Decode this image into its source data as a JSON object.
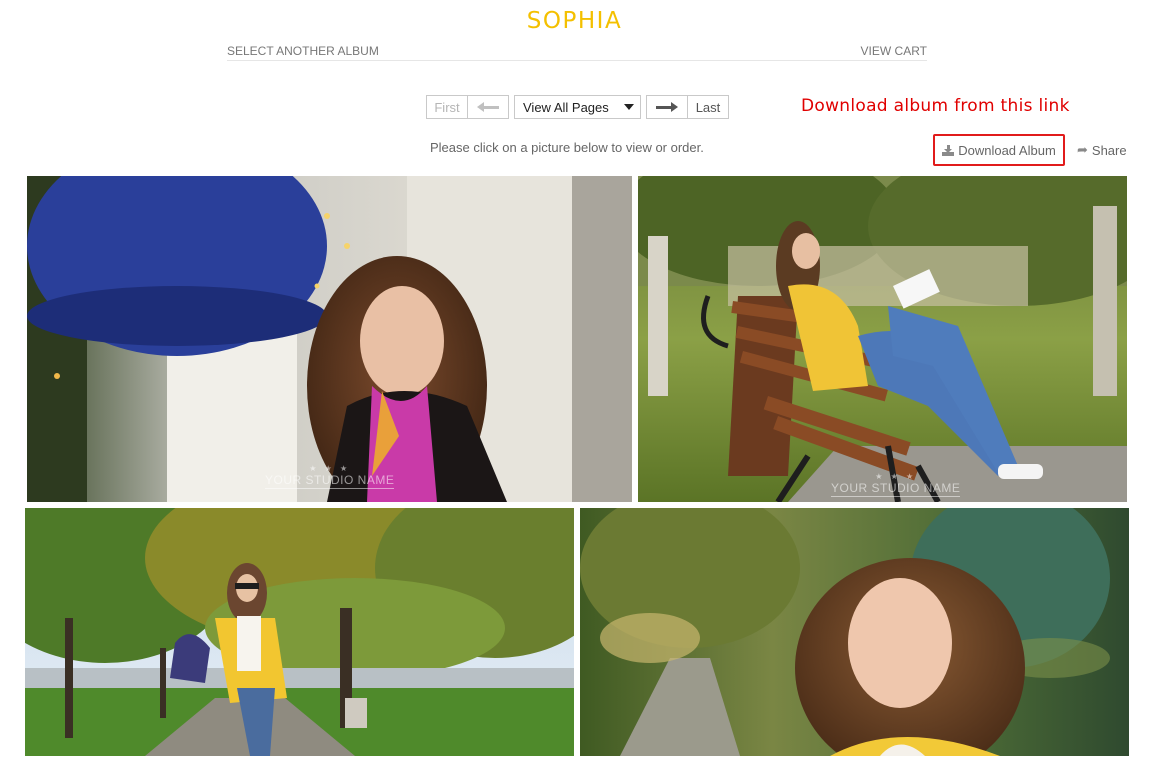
{
  "album": {
    "title": "SOPHIA"
  },
  "nav": {
    "select_album": "SELECT ANOTHER ALBUM",
    "view_cart": "VIEW CART"
  },
  "pager": {
    "first": "First",
    "view_all": "View All Pages",
    "last": "Last"
  },
  "annotation": "Download album from this link",
  "instruction": "Please click on a picture below to view or order.",
  "actions": {
    "download": "Download Album",
    "share": "Share"
  },
  "watermark": "YOUR STUDIO NAME",
  "colors": {
    "title": "#f4c000",
    "annotation": "#e00000",
    "highlight_box": "#e11b1b"
  }
}
